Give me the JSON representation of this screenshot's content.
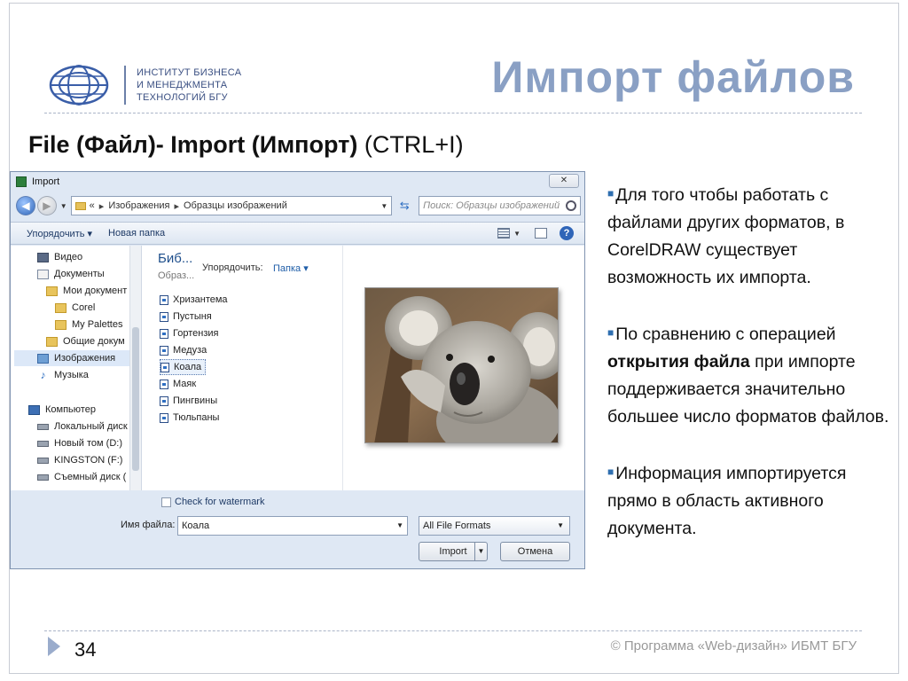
{
  "logo": {
    "lines": [
      "ИНСТИТУТ БИЗНЕСА",
      "И МЕНЕДЖМЕНТА",
      "ТЕХНОЛОГИЙ БГУ"
    ]
  },
  "slide": {
    "title": "Импорт файлов",
    "subtitle_bold": "File (Файл)- Import (Импорт)",
    "subtitle_plain": " (CTRL+I)",
    "page_number": "34",
    "copyright": "© Программа «Web-дизайн» ИБМТ БГУ"
  },
  "dialog": {
    "title": "Import",
    "address": {
      "prefix": "«",
      "crumb1": "Изображения",
      "crumb2": "Образцы изображений"
    },
    "search_placeholder": "Поиск: Образцы изображений",
    "toolbar": {
      "organize": "Упорядочить",
      "new_folder": "Новая папка"
    },
    "nav_items": [
      {
        "label": "Видео",
        "icon": "video-icon"
      },
      {
        "label": "Документы",
        "icon": "documents-icon"
      },
      {
        "label": "Мои документ",
        "icon": "folder-icon"
      },
      {
        "label": "Corel",
        "icon": "folder-icon"
      },
      {
        "label": "My Palettes",
        "icon": "folder-icon"
      },
      {
        "label": "Общие докум",
        "icon": "folder-icon"
      },
      {
        "label": "Изображения",
        "icon": "pictures-icon"
      },
      {
        "label": "Музыка",
        "icon": "music-icon"
      },
      {
        "label": "Компьютер",
        "icon": "computer-icon"
      },
      {
        "label": "Локальный диск",
        "icon": "drive-icon"
      },
      {
        "label": "Новый том (D:)",
        "icon": "drive-icon"
      },
      {
        "label": "KINGSTON (F:)",
        "icon": "drive-icon"
      },
      {
        "label": "Съемный диск (",
        "icon": "drive-icon"
      }
    ],
    "library": {
      "title": "Биб...",
      "subtitle": "Образ...",
      "arrange_label": "Упорядочить:",
      "arrange_value": "Папка"
    },
    "files": [
      "Хризантема",
      "Пустыня",
      "Гортензия",
      "Медуза",
      "Коала",
      "Маяк",
      "Пингвины",
      "Тюльпаны"
    ],
    "selected_file": "Коала",
    "watermark_label": "Check for watermark",
    "filename_label": "Имя файла:",
    "filename_value": "Коала",
    "format_value": "All File Formats",
    "import_label": "Import",
    "cancel_label": "Отмена"
  },
  "bullets": {
    "b1": "Для того чтобы работать с файлами других форматов, в CorelDRAW существует возможность их импорта.",
    "b2_pre": "По сравнению с операцией ",
    "b2_bold": "открытия файла",
    "b2_post": " при импорте поддерживается значительно большее число форматов файлов.",
    "b3": "Информация импортируется прямо в область активного документа."
  },
  "colors": {
    "title": "#8aa0c4",
    "accent": "#2f6fb0",
    "dialog_bg": "#dfe8f4"
  }
}
